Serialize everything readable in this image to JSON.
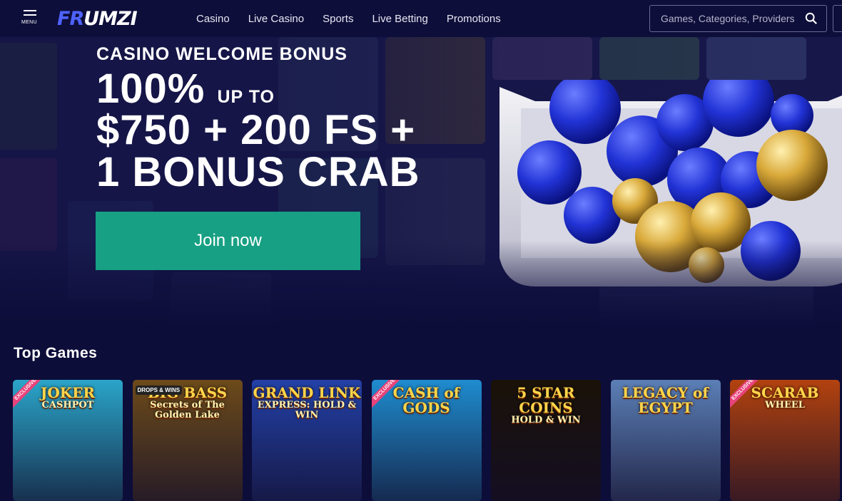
{
  "header": {
    "menu_label": "MENU",
    "logo_text": "FRUMZI",
    "nav": [
      "Casino",
      "Live Casino",
      "Sports",
      "Live Betting",
      "Promotions"
    ],
    "search_placeholder": "Games, Categories, Providers"
  },
  "hero": {
    "kicker": "CASINO WELCOME BONUS",
    "line1_big": "100%",
    "line1_small": "UP TO",
    "line2": "$750 + 200 FS +",
    "line3": "1 BONUS CRAB",
    "cta": "Join now",
    "colors": {
      "cta": "#17a083",
      "background": "#17174a"
    }
  },
  "top_games": {
    "title": "Top Games",
    "items": [
      {
        "title": "JOKER",
        "subtitle": "CASHPOT",
        "badge": "EXCLUSIVE",
        "bg": "#2aa5c9"
      },
      {
        "title": "BIG BASS",
        "subtitle": "Secrets of The Golden Lake",
        "badge": "DROPS & WINS",
        "bg": "#6c4a1a"
      },
      {
        "title": "GRAND LINK",
        "subtitle": "EXPRESS: HOLD & WIN",
        "badge": "",
        "bg": "#2341a8"
      },
      {
        "title": "CASH of GODS",
        "subtitle": "",
        "badge": "EXCLUSIVE",
        "bg": "#1f8ccf"
      },
      {
        "title": "5 STAR COINS",
        "subtitle": "HOLD & WIN",
        "badge": "",
        "bg": "#1a1208"
      },
      {
        "title": "LEGACY of EGYPT",
        "subtitle": "",
        "badge": "",
        "bg": "#5b7fb6"
      },
      {
        "title": "SCARAB",
        "subtitle": "WHEEL",
        "badge": "EXCLUSIVE",
        "bg": "#b3420f"
      }
    ]
  }
}
